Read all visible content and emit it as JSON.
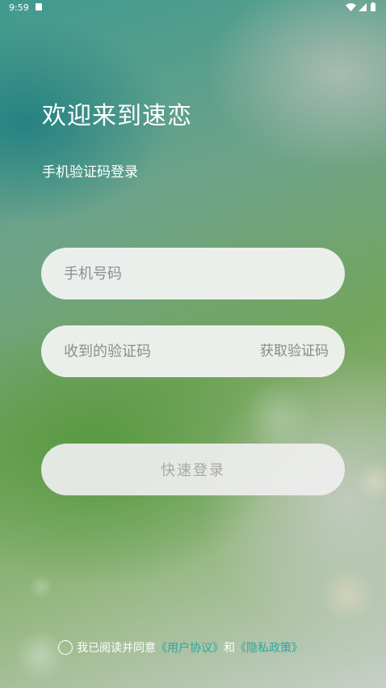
{
  "status_bar": {
    "time": "9:59",
    "icons": [
      "notification-icon",
      "wifi-icon",
      "signal-icon",
      "battery-icon"
    ]
  },
  "welcome": {
    "title": "欢迎来到速恋",
    "subtitle": "手机验证码登录"
  },
  "form": {
    "phone_placeholder": "手机号码",
    "phone_value": "",
    "code_placeholder": "收到的验证码",
    "code_value": "",
    "get_code_label": "获取验证码",
    "login_label": "快速登录"
  },
  "agreement": {
    "checked": false,
    "text": "我已阅读并同意",
    "user_agreement": "《用户协议》",
    "and": "和",
    "privacy_policy": "《隐私政策》"
  },
  "colors": {
    "link": "#2aa7a0",
    "field_bg": "#f4f4f4",
    "placeholder": "#8e8e8e",
    "button_text_disabled": "#a8a8a8"
  }
}
